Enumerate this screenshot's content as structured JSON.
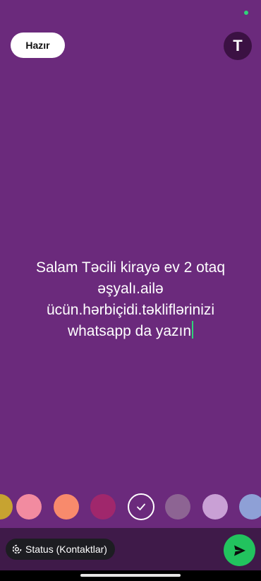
{
  "header": {
    "done_label": "Hazır",
    "text_tool_label": "T"
  },
  "editor": {
    "lines": [
      "Salam Təcili kirayə ev 2 otaq",
      "əşyalı.ailə",
      "ücün.hərbiçidi.təkliflərinizi",
      "whatsapp da yazın"
    ]
  },
  "palette": {
    "colors": [
      "#c7a331",
      "#f28ba0",
      "#f88a6c",
      "#a0276c",
      "#6b2a7c",
      "#8d6493",
      "#c9a0d5",
      "#8ea0d6"
    ],
    "selected_index": 4
  },
  "footer": {
    "audience_label": "Status (Kontaktlar)"
  },
  "icons": {
    "text_tool": "text-format-icon",
    "audience": "status-ring-icon",
    "send": "send-arrow-icon",
    "check": "check-icon"
  },
  "colors": {
    "background": "#6b2a7c",
    "accent": "#22c35e",
    "caret": "#2fd37a"
  }
}
